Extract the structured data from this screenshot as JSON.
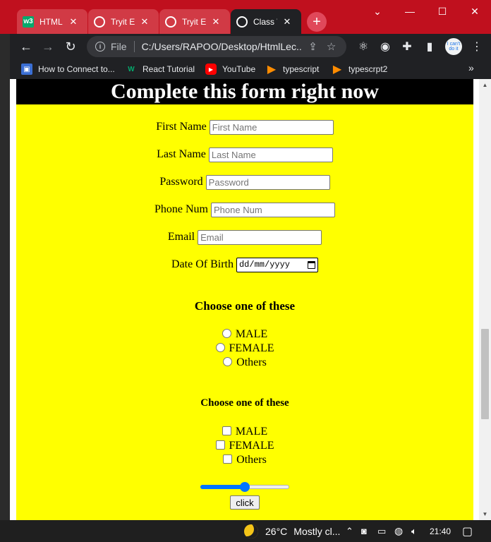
{
  "browser": {
    "tabs": [
      {
        "title": "HTML L",
        "favicon": "w3",
        "favicon_color": "#04aa6d",
        "active": false
      },
      {
        "title": "Tryit Ed",
        "favicon": "globe",
        "favicon_color": "#ffffff",
        "active": false
      },
      {
        "title": "Tryit Ed",
        "favicon": "globe",
        "favicon_color": "#ffffff",
        "active": false
      },
      {
        "title": "Class W",
        "favicon": "globe",
        "favicon_color": "#ffffff",
        "active": true
      }
    ],
    "new_tab": "+",
    "window_buttons": {
      "dropdown": "⌄",
      "minimize": "—",
      "maximize": "☐",
      "close": "✕"
    },
    "address": {
      "scheme": "File",
      "url": "C:/Users/RAPOO/Desktop/HtmlLec..."
    },
    "avatar_text": "I can't do it",
    "bookmarks": [
      {
        "label": "How to Connect to...",
        "icon": "floppy-icon",
        "color": "#3b6fd4"
      },
      {
        "label": "React Tutorial",
        "icon": "w3-icon",
        "color": "#04aa6d"
      },
      {
        "label": "YouTube",
        "icon": "youtube-icon",
        "color": "#ff0000"
      },
      {
        "label": "typescript",
        "icon": "typescript-icon",
        "color": "#ff8c00"
      },
      {
        "label": "typescrpt2",
        "icon": "typescript-icon",
        "color": "#ff8c00"
      }
    ],
    "bookmarks_more": "»"
  },
  "page": {
    "heading": "Complete this form right now",
    "fields": [
      {
        "label": "First Name",
        "placeholder": "First Name"
      },
      {
        "label": "Last Name",
        "placeholder": "Last Name"
      },
      {
        "label": "Password",
        "placeholder": "Password"
      },
      {
        "label": "Phone Num",
        "placeholder": "Phone Num"
      },
      {
        "label": "Email",
        "placeholder": "Email"
      }
    ],
    "dob": {
      "label": "Date Of Birth",
      "placeholder": "dd/mm/yyyy"
    },
    "radio_section": {
      "title": "Choose one of these",
      "options": [
        "MALE",
        "FEMALE",
        "Others"
      ]
    },
    "checkbox_section": {
      "title": "Choose one of these",
      "options": [
        "MALE",
        "FEMALE",
        "Others"
      ]
    },
    "slider": {
      "value_fraction": 0.5
    },
    "button_label": "click"
  },
  "taskbar": {
    "weather": "26°C",
    "condition": "Mostly cl...",
    "time": "21:40"
  },
  "colors": {
    "page_bg": "#ffff00",
    "header_bg": "#000000",
    "titlebar": "#c0101e",
    "accent": "#0075ff"
  }
}
